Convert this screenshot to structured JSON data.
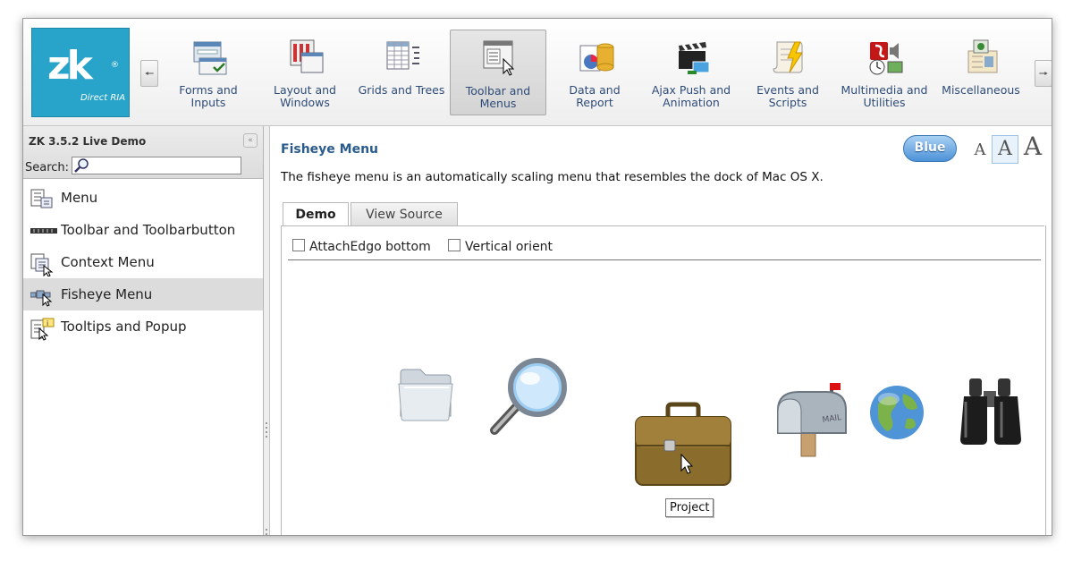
{
  "logo": {
    "mark": "zk",
    "reg": "®",
    "tagline": "Direct RIA"
  },
  "toolbar": {
    "items": [
      {
        "label": "Forms and\nInputs"
      },
      {
        "label": "Layout and\nWindows"
      },
      {
        "label": "Grids and Trees"
      },
      {
        "label": "Toolbar and\nMenus"
      },
      {
        "label": "Data and\nReport"
      },
      {
        "label": "Ajax Push and\nAnimation"
      },
      {
        "label": "Events and\nScripts"
      },
      {
        "label": "Multimedia and\nUtilities"
      },
      {
        "label": "Miscellaneous"
      }
    ],
    "selected": "Toolbar and Menus"
  },
  "sidebar": {
    "title": "ZK 3.5.2 Live Demo",
    "search_label": "Search:",
    "search_value": "",
    "items": [
      {
        "label": "Menu"
      },
      {
        "label": "Toolbar and Toolbarbutton"
      },
      {
        "label": "Context Menu"
      },
      {
        "label": "Fisheye Menu"
      },
      {
        "label": "Tooltips and Popup"
      }
    ],
    "selected": "Fisheye Menu"
  },
  "main": {
    "title": "Fisheye Menu",
    "description": "The fisheye menu is an automatically scaling menu that resembles the dock of Mac OS X.",
    "theme_button": "Blue",
    "font_sizes": [
      "A",
      "A",
      "A"
    ],
    "tabs": [
      {
        "label": "Demo"
      },
      {
        "label": "View Source"
      }
    ],
    "options": [
      {
        "label": "AttachEdgo bottom"
      },
      {
        "label": "Vertical orient"
      }
    ],
    "fisheye_tooltip": "Project"
  }
}
